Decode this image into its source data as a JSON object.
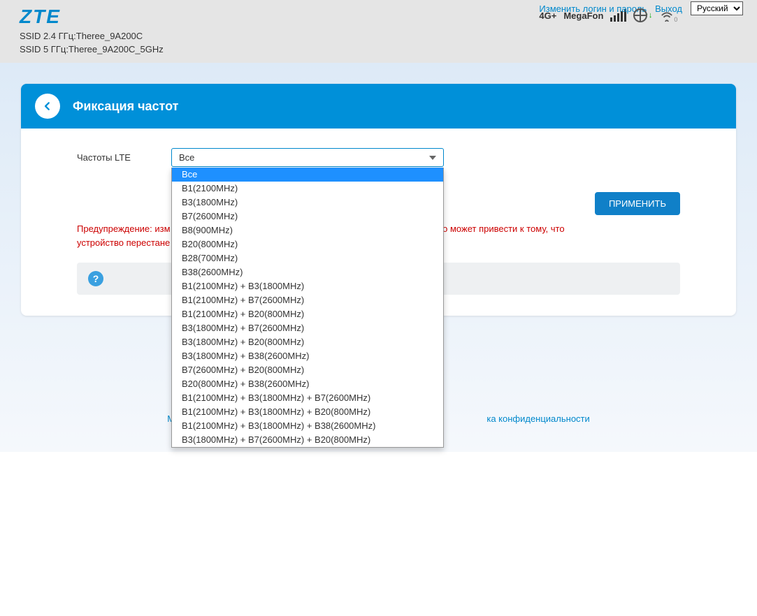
{
  "header": {
    "logo": "ZTE",
    "ssid24_label": "SSID 2.4 ГГц:Theree_9A200C",
    "ssid5_label": "SSID 5 ГГц:Theree_9A200C_5GHz",
    "network_mode": "4G+",
    "operator": "MegaFon",
    "change_login": "Изменить логин и пароль",
    "logout": "Выход",
    "language": "Русский"
  },
  "page": {
    "title": "Фиксация частот",
    "field_label": "Частоты LTE",
    "selected": "Все",
    "options": [
      "Все",
      "B1(2100MHz)",
      "B3(1800MHz)",
      "B7(2600MHz)",
      "B8(900MHz)",
      "B20(800MHz)",
      "B28(700MHz)",
      "B38(2600MHz)",
      "B1(2100MHz) + B3(1800MHz)",
      "B1(2100MHz) + B7(2600MHz)",
      "B1(2100MHz) + B20(800MHz)",
      "B3(1800MHz) + B7(2600MHz)",
      "B3(1800MHz) + B20(800MHz)",
      "B3(1800MHz) + B38(2600MHz)",
      "B7(2600MHz) + B20(800MHz)",
      "B20(800MHz) + B38(2600MHz)",
      "B1(2100MHz) + B3(1800MHz) + B7(2600MHz)",
      "B1(2100MHz) + B3(1800MHz) + B20(800MHz)",
      "B1(2100MHz) + B3(1800MHz) + B38(2600MHz)",
      "B3(1800MHz) + B7(2600MHz) + B20(800MHz)"
    ],
    "apply_label": "ПРИМЕНИТЬ",
    "warning_prefix": "Предупреждение: изм",
    "warning_suffix": ". Это может привести к тому, что",
    "warning_line2": "устройство перестане"
  },
  "footer": {
    "item1": "Модифицирова",
    "item2": "ка конфиденциальности"
  }
}
